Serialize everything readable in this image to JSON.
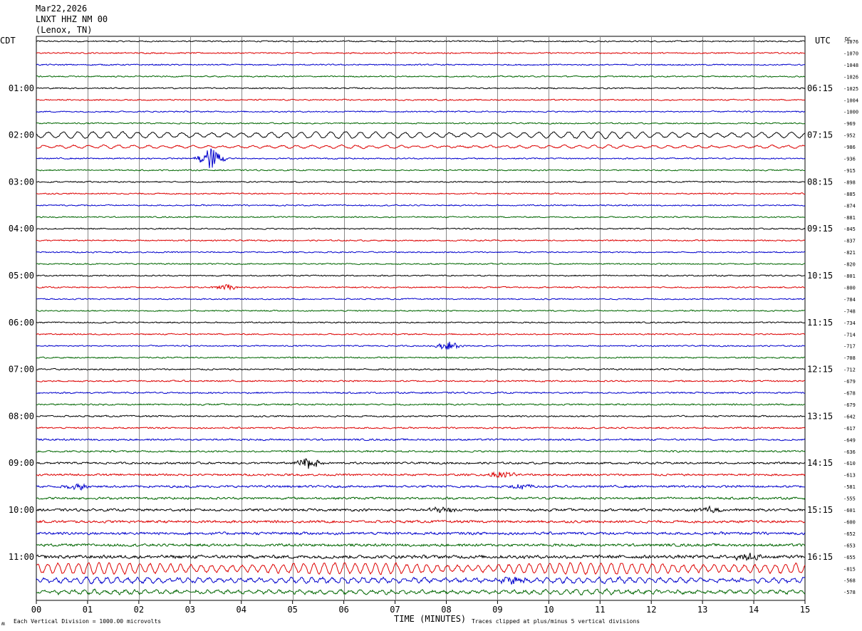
{
  "header": {
    "date": "Mar22,2026",
    "station": "LNXT HHZ NM 00",
    "location": "(Lenox, TN)"
  },
  "axes": {
    "left_label": "CDT",
    "right_label": "UTC",
    "right_col_label": "DC",
    "xlabel": "TIME (MINUTES)",
    "xticks": [
      "00",
      "01",
      "02",
      "03",
      "04",
      "05",
      "06",
      "07",
      "08",
      "09",
      "10",
      "11",
      "12",
      "13",
      "14",
      "15"
    ]
  },
  "footer": {
    "left": "Each Vertical Division = 1000.00 microvolts",
    "right": "Traces clipped at plus/minus 5 vertical divisions",
    "corner": "ʍ"
  },
  "colors": {
    "trace_cycle": [
      "#000000",
      "#dd0000",
      "#0000cc",
      "#006600"
    ],
    "grid": "#888888"
  },
  "chart_data": {
    "type": "line",
    "title": "",
    "xlim": [
      0,
      15
    ],
    "trace_minutes": 15,
    "row_count": 48,
    "cdt_labels": [
      {
        "row": 4,
        "text": "01:00"
      },
      {
        "row": 8,
        "text": "02:00"
      },
      {
        "row": 12,
        "text": "03:00"
      },
      {
        "row": 16,
        "text": "04:00"
      },
      {
        "row": 20,
        "text": "05:00"
      },
      {
        "row": 24,
        "text": "06:00"
      },
      {
        "row": 28,
        "text": "07:00"
      },
      {
        "row": 32,
        "text": "08:00"
      },
      {
        "row": 36,
        "text": "09:00"
      },
      {
        "row": 40,
        "text": "10:00"
      },
      {
        "row": 44,
        "text": "11:00"
      }
    ],
    "utc_labels": [
      {
        "row": 4,
        "text": "06:15"
      },
      {
        "row": 8,
        "text": "07:15"
      },
      {
        "row": 12,
        "text": "08:15"
      },
      {
        "row": 16,
        "text": "09:15"
      },
      {
        "row": 20,
        "text": "10:15"
      },
      {
        "row": 24,
        "text": "11:15"
      },
      {
        "row": 28,
        "text": "12:15"
      },
      {
        "row": 32,
        "text": "13:15"
      },
      {
        "row": 36,
        "text": "14:15"
      },
      {
        "row": 40,
        "text": "15:15"
      },
      {
        "row": 44,
        "text": "16:15"
      }
    ],
    "dc_offsets": [
      "-1076",
      "-1070",
      "-1048",
      "-1026",
      "-1025",
      "-1004",
      "-1000",
      "-969",
      "-952",
      "-986",
      "-936",
      "-915",
      "-898",
      "-885",
      "-874",
      "-881",
      "-845",
      "-837",
      "-821",
      "-820",
      "-801",
      "-800",
      "-784",
      "-748",
      "-734",
      "-714",
      "-717",
      "-708",
      "-712",
      "-679",
      "-678",
      "-679",
      "-642",
      "-617",
      "-649",
      "-636",
      "-610",
      "-613",
      "-581",
      "-555",
      "-601",
      "-600",
      "-652",
      "-653",
      "-655",
      "-815",
      "-568",
      "-578"
    ],
    "noise_levels": [
      1.2,
      1.2,
      1.2,
      1.2,
      1.2,
      1.2,
      1.2,
      1.2,
      1.0,
      1.2,
      1.2,
      1.2,
      1.2,
      1.2,
      1.2,
      1.2,
      1.2,
      1.2,
      1.2,
      1.2,
      1.2,
      1.2,
      1.2,
      1.2,
      1.2,
      1.2,
      1.2,
      1.2,
      1.4,
      1.4,
      1.4,
      1.4,
      1.4,
      1.4,
      1.6,
      1.6,
      1.8,
      1.8,
      2.0,
      2.0,
      2.2,
      2.2,
      2.4,
      2.4,
      3.0,
      2.0,
      2.5,
      2.5
    ],
    "oscillations": [
      {
        "row": 8,
        "amplitude": 4.5,
        "period_min": 0.29
      },
      {
        "row": 9,
        "amplitude": 2.0,
        "period_min": 0.29
      },
      {
        "row": 45,
        "amplitude": 7.5,
        "period_min": 0.2
      },
      {
        "row": 46,
        "amplitude": 3.5,
        "period_min": 0.2
      },
      {
        "row": 47,
        "amplitude": 2.5,
        "period_min": 0.2
      }
    ],
    "events": [
      {
        "row": 10,
        "minute": 3.4,
        "amplitude": 16
      },
      {
        "row": 21,
        "minute": 3.7,
        "amplitude": 4
      },
      {
        "row": 26,
        "minute": 8.05,
        "amplitude": 6
      },
      {
        "row": 36,
        "minute": 5.3,
        "amplitude": 8
      },
      {
        "row": 37,
        "minute": 9.1,
        "amplitude": 5
      },
      {
        "row": 38,
        "minute": 0.8,
        "amplitude": 5
      },
      {
        "row": 38,
        "minute": 9.5,
        "amplitude": 4
      },
      {
        "row": 40,
        "minute": 7.9,
        "amplitude": 5
      },
      {
        "row": 40,
        "minute": 13.1,
        "amplitude": 5
      },
      {
        "row": 44,
        "minute": 13.9,
        "amplitude": 6
      },
      {
        "row": 46,
        "minute": 9.3,
        "amplitude": 5
      }
    ]
  }
}
